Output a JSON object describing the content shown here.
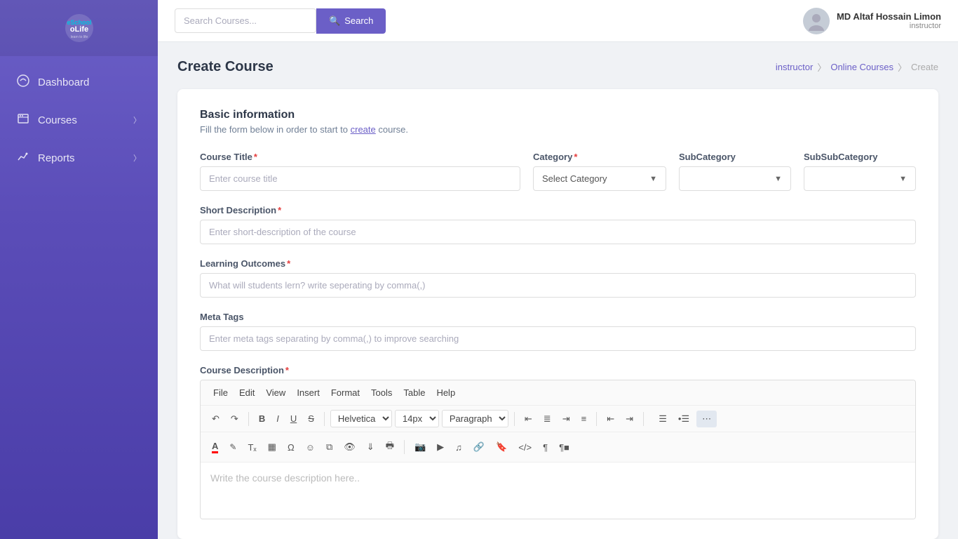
{
  "sidebar": {
    "logo": {
      "line1": "eSchool",
      "line2": "oLife",
      "tagline": "learn to life"
    },
    "items": [
      {
        "id": "dashboard",
        "label": "Dashboard",
        "icon": "dashboard-icon",
        "hasChevron": false
      },
      {
        "id": "courses",
        "label": "Courses",
        "icon": "courses-icon",
        "hasChevron": true
      },
      {
        "id": "reports",
        "label": "Reports",
        "icon": "reports-icon",
        "hasChevron": true
      }
    ]
  },
  "topbar": {
    "search_placeholder": "Search Courses...",
    "search_label": "Search",
    "user": {
      "name": "MD Altaf Hossain Limon",
      "role": "instructor"
    }
  },
  "page": {
    "title": "Create Course",
    "breadcrumb": {
      "items": [
        "instructor",
        "Online Courses",
        "Create"
      ]
    }
  },
  "form": {
    "section_title": "Basic information",
    "section_desc_prefix": "Fill the form below in order to start to",
    "section_desc_link": "create",
    "section_desc_suffix": "course.",
    "course_title": {
      "label": "Course Title",
      "required": true,
      "placeholder": "Enter course title"
    },
    "category": {
      "label": "Category",
      "required": true,
      "placeholder": "Select Category"
    },
    "subcategory": {
      "label": "SubCategory",
      "required": false,
      "placeholder": ""
    },
    "subsubcategory": {
      "label": "SubSubCategory",
      "required": false,
      "placeholder": ""
    },
    "short_description": {
      "label": "Short Description",
      "required": true,
      "placeholder": "Enter short-description of the course"
    },
    "learning_outcomes": {
      "label": "Learning Outcomes",
      "required": true,
      "placeholder": "What will students lern? write seperating by comma(,)"
    },
    "meta_tags": {
      "label": "Meta Tags",
      "required": false,
      "placeholder": "Enter meta tags separating by comma(,) to improve searching"
    },
    "course_description": {
      "label": "Course Description",
      "required": true,
      "editor": {
        "menus": [
          "File",
          "Edit",
          "View",
          "Insert",
          "Format",
          "Tools",
          "Table",
          "Help"
        ],
        "font": "Helvetica",
        "size": "14px",
        "paragraph": "Paragraph",
        "placeholder": "Write the course description here.."
      }
    }
  }
}
